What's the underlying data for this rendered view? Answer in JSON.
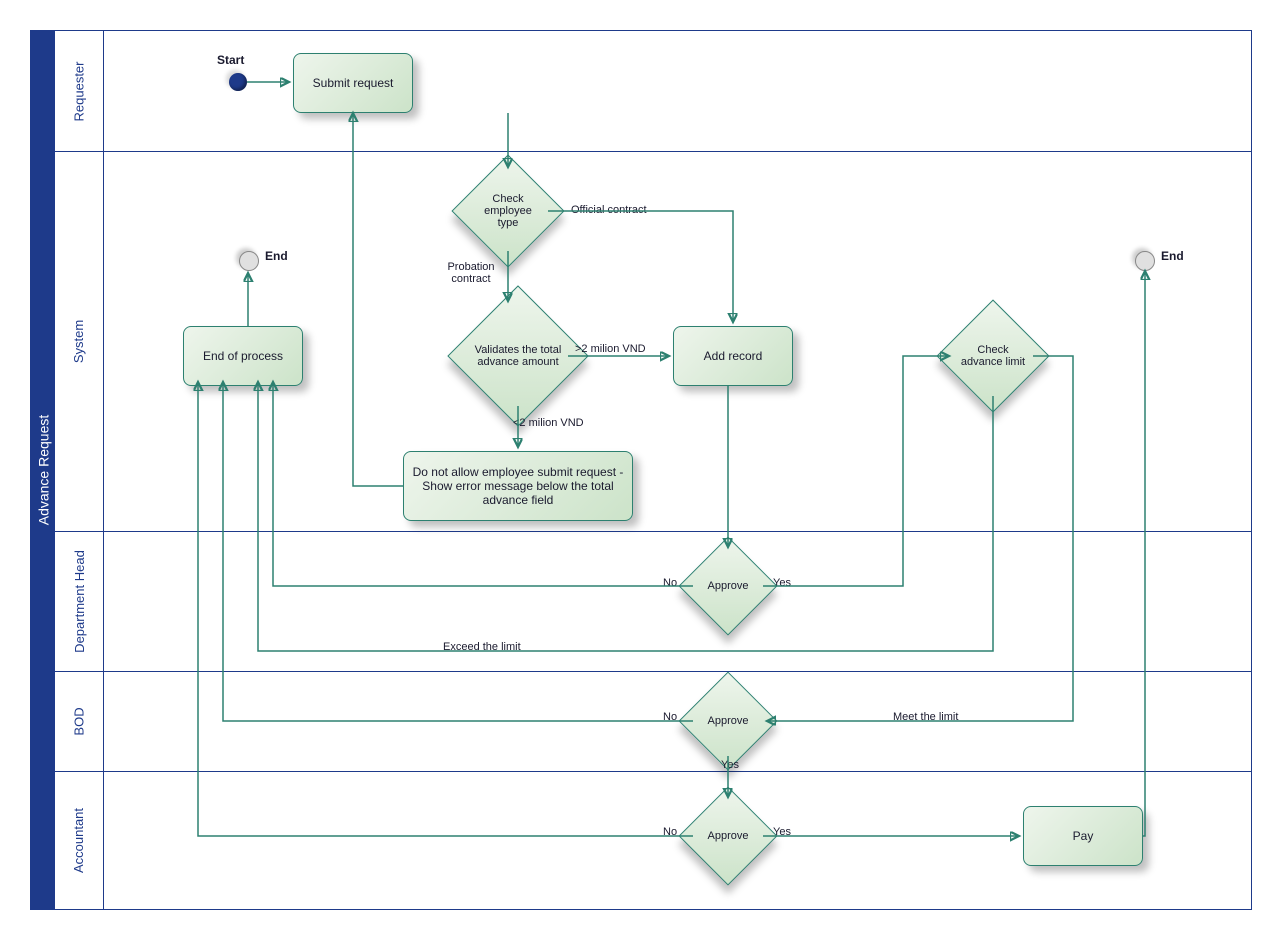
{
  "pool": {
    "title": "Advance Request"
  },
  "lanes": {
    "requester": {
      "title": "Requester"
    },
    "system": {
      "title": "System"
    },
    "deptHead": {
      "title": "Department Head"
    },
    "bod": {
      "title": "BOD"
    },
    "accountant": {
      "title": "Accountant"
    }
  },
  "nodes": {
    "start": "Start",
    "submit": "Submit request",
    "checkType": "Check employee type",
    "validate": "Validates the total advance amount",
    "addRecord": "Add record",
    "checkLimit": "Check advance limit",
    "notAllow": "Do not allow employee submit request - Show error message below the total advance field",
    "endProc": "End of process",
    "end1": "End",
    "end2": "End",
    "approve1": "Approve",
    "approve2": "Approve",
    "approve3": "Approve",
    "pay": "Pay"
  },
  "labels": {
    "official": "Official contract",
    "probation": "Probation contract",
    "gt2m": ">2 milion VND",
    "lt2m": "<2 milion VND",
    "yes": "Yes",
    "no": "No",
    "exceed": "Exceed the limit",
    "meet": "Meet the limit"
  }
}
